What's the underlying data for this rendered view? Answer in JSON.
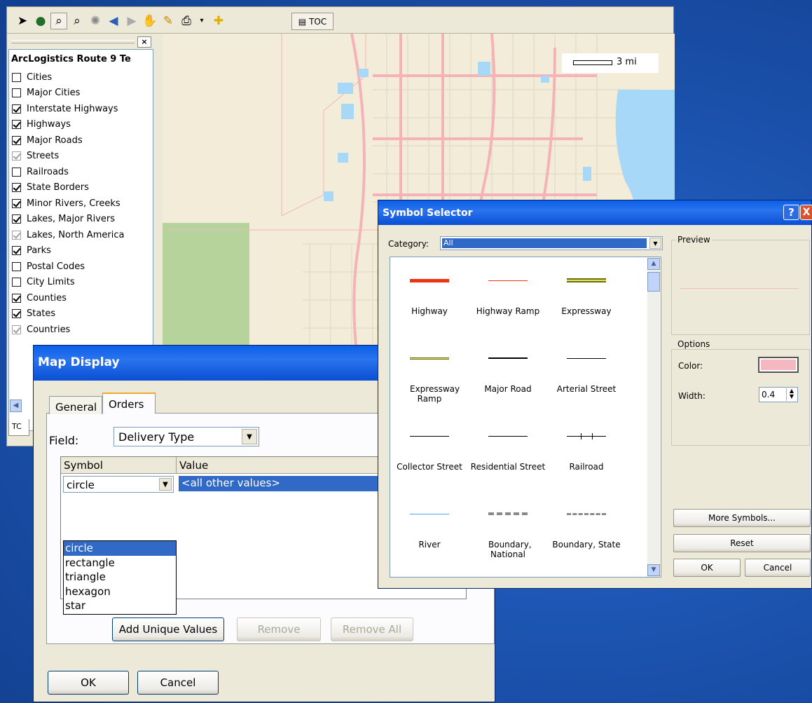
{
  "map_window": {
    "toolbar": {
      "toc_label": "TOC",
      "icons": [
        "select-arrow-icon",
        "globe-icon",
        "zoom-in-icon",
        "zoom-out-icon",
        "full-extent-icon",
        "back-icon",
        "forward-icon",
        "pan-hand-icon",
        "edit-pencil-icon",
        "print-icon",
        "dropdown-icon",
        "add-data-icon",
        "toc-icon"
      ]
    },
    "toc": {
      "title": "ArcLogistics Route 9 Te",
      "tab_label": "TC",
      "layers": [
        {
          "label": "Cities",
          "state": "unchecked"
        },
        {
          "label": "Major Cities",
          "state": "unchecked"
        },
        {
          "label": "Interstate Highways",
          "state": "checked"
        },
        {
          "label": "Highways",
          "state": "checked"
        },
        {
          "label": "Major Roads",
          "state": "checked"
        },
        {
          "label": "Streets",
          "state": "grey"
        },
        {
          "label": "Railroads",
          "state": "unchecked"
        },
        {
          "label": "State Borders",
          "state": "checked"
        },
        {
          "label": "Minor Rivers, Creeks",
          "state": "checked"
        },
        {
          "label": "Lakes, Major Rivers",
          "state": "checked"
        },
        {
          "label": "Lakes, North America",
          "state": "grey"
        },
        {
          "label": "Parks",
          "state": "checked"
        },
        {
          "label": "Postal Codes",
          "state": "unchecked"
        },
        {
          "label": "City Limits",
          "state": "unchecked"
        },
        {
          "label": "Counties",
          "state": "checked"
        },
        {
          "label": "States",
          "state": "checked"
        },
        {
          "label": "Countries",
          "state": "grey"
        }
      ]
    },
    "scale_label": "3 mi",
    "colors": {
      "background": "#f3ecd9",
      "roads": "#f5b3b8",
      "water": "#a8d8f8",
      "park": "#b5d39b"
    }
  },
  "map_display": {
    "title": "Map Display",
    "tabs": [
      "General",
      "Orders"
    ],
    "field_label": "Field:",
    "field_value": "Delivery Type",
    "table_headers": [
      "Symbol",
      "Value"
    ],
    "symbol_value": "circle",
    "row_value": "<all other values>",
    "symbol_options": [
      "circle",
      "rectangle",
      "triangle",
      "hexagon",
      "star"
    ],
    "buttons": {
      "add_unique": "Add Unique Values",
      "remove": "Remove",
      "remove_all": "Remove All",
      "ok": "OK",
      "cancel": "Cancel"
    }
  },
  "symbol_selector": {
    "title": "Symbol Selector",
    "help_glyph": "?",
    "close_glyph": "X",
    "category_label": "Category:",
    "category_value": "All",
    "symbols": [
      {
        "name": "Highway",
        "color": "#ee3312",
        "style": "solid"
      },
      {
        "name": "Highway Ramp",
        "color": "#ee3312",
        "style": "thin"
      },
      {
        "name": "Expressway",
        "color": "#6b6b10",
        "style": "double"
      },
      {
        "name": "Expressway Ramp",
        "color": "#6b6b10",
        "style": "thin-double"
      },
      {
        "name": "Major Road",
        "color": "#000000",
        "style": "solid-thin"
      },
      {
        "name": "Arterial Street",
        "color": "#000000",
        "style": "thin"
      },
      {
        "name": "Collector Street",
        "color": "#000000",
        "style": "thin"
      },
      {
        "name": "Residential Street",
        "color": "#000000",
        "style": "thin"
      },
      {
        "name": "Railroad",
        "color": "#000000",
        "style": "rail"
      },
      {
        "name": "River",
        "color": "#4aa8e8",
        "style": "thin"
      },
      {
        "name": "Boundary, National",
        "color": "#8a8a8a",
        "style": "dashed-thick"
      },
      {
        "name": "Boundary, State",
        "color": "#8a8a8a",
        "style": "dashed"
      }
    ],
    "preview_label": "Preview",
    "options_label": "Options",
    "color_label": "Color:",
    "color_value": "#f6b8c0",
    "width_label": "Width:",
    "width_value": "0.4",
    "buttons": {
      "more": "More Symbols...",
      "reset": "Reset",
      "ok": "OK",
      "cancel": "Cancel"
    }
  }
}
